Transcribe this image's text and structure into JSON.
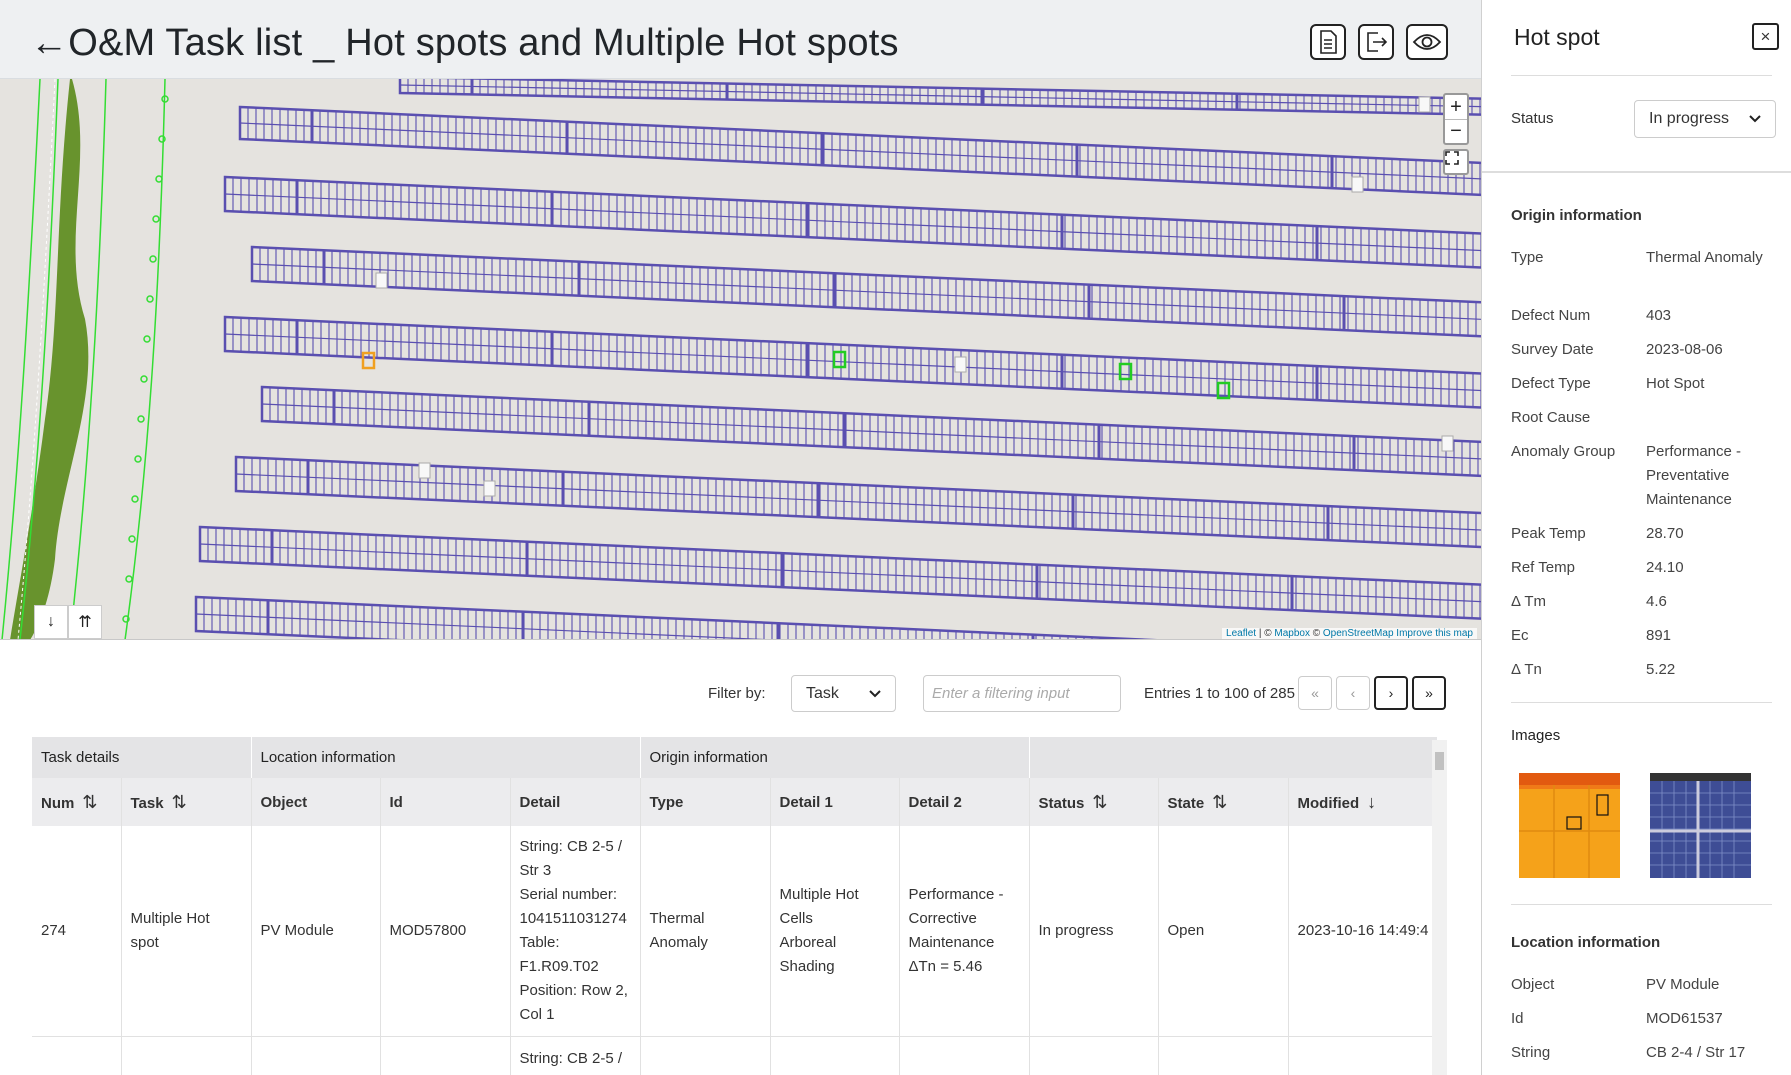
{
  "header": {
    "title": "←O&M Task list _ Hot spots and Multiple Hot spots",
    "buttons": [
      {
        "name": "report-icon"
      },
      {
        "name": "export-icon"
      },
      {
        "name": "eye-icon"
      }
    ]
  },
  "map": {
    "zoom_in": "+",
    "zoom_out": "−",
    "arrows": [
      "↓",
      "⇈"
    ],
    "attribution": {
      "leaflet": "Leaflet",
      "sep1": " | © ",
      "mapbox": "Mapbox",
      "sep2": " © ",
      "osm": "OpenStreetMap",
      "improve": " Improve this map"
    }
  },
  "filter": {
    "label": "Filter by:",
    "selected": "Task",
    "placeholder": "Enter a filtering input",
    "entries": "Entries 1 to 100 of 285",
    "pager": [
      "«",
      "‹",
      "›",
      "»"
    ]
  },
  "table": {
    "groups": [
      "Task details",
      "Location information",
      "Origin information",
      ""
    ],
    "columns": [
      {
        "label": "Num",
        "sort": "⇅"
      },
      {
        "label": "Task",
        "sort": "⇅"
      },
      {
        "label": "Object",
        "sort": ""
      },
      {
        "label": "Id",
        "sort": ""
      },
      {
        "label": "Detail",
        "sort": ""
      },
      {
        "label": "Type",
        "sort": ""
      },
      {
        "label": "Detail 1",
        "sort": ""
      },
      {
        "label": "Detail 2",
        "sort": ""
      },
      {
        "label": "Status",
        "sort": "⇅"
      },
      {
        "label": "State",
        "sort": "⇅"
      },
      {
        "label": "Modified",
        "sort": "↓"
      }
    ],
    "rows": [
      {
        "num": "274",
        "task": "Multiple Hot spot",
        "object": "PV Module",
        "id": "MOD57800",
        "detail": [
          "String: CB 2-5 / Str 3",
          "Serial number: 1041511031274",
          "Table: F1.R09.T02",
          "Position: Row 2, Col 1"
        ],
        "type": "Thermal Anomaly",
        "detail1": [
          "Multiple Hot Cells",
          "Arboreal Shading"
        ],
        "detail2": [
          "Performance - Corrective Maintenance",
          "ΔTn = 5.46"
        ],
        "status": "In progress",
        "state": "Open",
        "modified": "2023-10-16 14:49:4"
      },
      {
        "detail": [
          "String: CB 2-5 /"
        ]
      }
    ]
  },
  "panel": {
    "title": "Hot spot",
    "close": "×",
    "status_label": "Status",
    "status_value": "In progress",
    "origin_title": "Origin information",
    "origin": [
      {
        "k": "Type",
        "v": "Thermal Anomaly"
      },
      {
        "k": "Defect Num",
        "v": "403"
      },
      {
        "k": "Survey Date",
        "v": "2023-08-06"
      },
      {
        "k": "Defect Type",
        "v": "Hot Spot"
      },
      {
        "k": "Root Cause",
        "v": ""
      },
      {
        "k": "Anomaly Group",
        "v": "Performance - Preventative Maintenance"
      },
      {
        "k": "Peak Temp",
        "v": "28.70"
      },
      {
        "k": "Ref Temp",
        "v": "24.10"
      },
      {
        "k": "Δ Tm",
        "v": "4.6"
      },
      {
        "k": "Ec",
        "v": "891"
      },
      {
        "k": "Δ Tn",
        "v": "5.22"
      }
    ],
    "images_title": "Images",
    "location_title": "Location information",
    "location": [
      {
        "k": "Object",
        "v": "PV Module"
      },
      {
        "k": "Id",
        "v": "MOD61537"
      },
      {
        "k": "String",
        "v": "CB 2-4 / Str 17"
      }
    ]
  },
  "colors": {
    "panel_rows": "#5a4fb0",
    "vegetation": "#5a8a1a",
    "boundary": "#33dd33",
    "hotspot_green": "#22cc22",
    "hotspot_orange": "#f0a020"
  }
}
